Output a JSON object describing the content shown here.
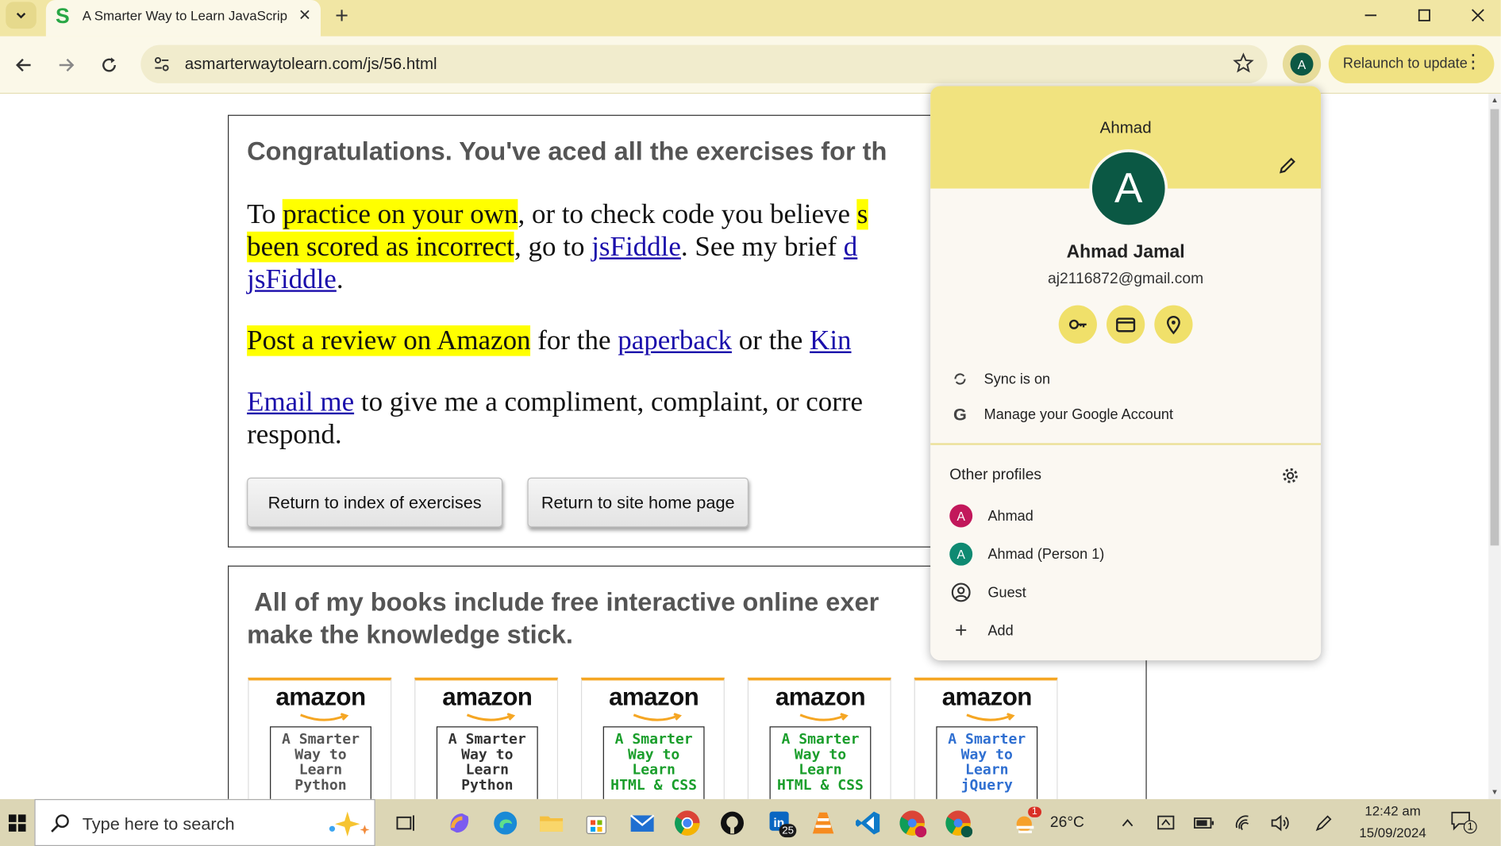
{
  "browser": {
    "tab_title": "A Smarter Way to Learn JavaScript",
    "tab_favicon": "S",
    "new_tab_symbol": "+",
    "url": "asmarterwaytolearn.com/js/56.html",
    "relaunch_label": "Relaunch to update",
    "profile_initial": "A",
    "accent_color": "#f1e6a4"
  },
  "page": {
    "heading": "Congratulations. You've aced all the exercises for th",
    "p1": {
      "t1": "To ",
      "hl1": "practice on your own",
      "t2": ", or to check code you believe ",
      "hl2": "s",
      "hl3": "been scored as incorrect",
      "t3": ", go to ",
      "link1": "jsFiddle",
      "t4": ". See my brief ",
      "link2": "d",
      "link3": "jsFiddle",
      "t5": "."
    },
    "p2": {
      "hl": "Post a review on Amazon",
      "t1": " for the ",
      "link1": "paperback",
      "t2": " or the ",
      "link2": "Kin"
    },
    "p3": {
      "link": "Email me",
      "t1": " to give me a compliment, complaint, or corre",
      "t2": "respond."
    },
    "buttons": {
      "index": "Return to index of exercises",
      "home": "Return to site home page"
    },
    "books_heading_line1": "All of my books include free interactive online exer",
    "books_heading_line2": "make the knowledge stick.",
    "books": [
      {
        "brand": "amazon",
        "l1": "A Smarter",
        "l2": "Way to",
        "l3": "Learn",
        "l4": "Python",
        "color": "#555555"
      },
      {
        "brand": "amazon",
        "l1": "A Smarter",
        "l2": "Way to",
        "l3": "Learn",
        "l4": "Python",
        "color": "#333333"
      },
      {
        "brand": "amazon",
        "l1": "A Smarter",
        "l2": "Way to",
        "l3": "Learn",
        "l4": "HTML & CSS",
        "color": "#1a9e2b"
      },
      {
        "brand": "amazon",
        "l1": "A Smarter",
        "l2": "Way to",
        "l3": "Learn",
        "l4": "HTML & CSS",
        "color": "#1a9e2b"
      },
      {
        "brand": "amazon",
        "l1": "A Smarter",
        "l2": "Way to",
        "l3": "Learn",
        "l4": "jQuery",
        "color": "#2f6fd1"
      }
    ]
  },
  "profile_menu": {
    "header_name": "Ahmad",
    "avatar_initial": "A",
    "full_name": "Ahmad Jamal",
    "email": "aj2116872@gmail.com",
    "sync_label": "Sync is on",
    "manage_label": "Manage your Google Account",
    "other_profiles_title": "Other profiles",
    "profiles": [
      {
        "initial": "A",
        "name": "Ahmad",
        "color": "#c2185b"
      },
      {
        "initial": "A",
        "name": "Ahmad (Person 1)",
        "color": "#0f8a72"
      }
    ],
    "guest_label": "Guest",
    "add_label": "Add"
  },
  "taskbar": {
    "search_placeholder": "Type here to search",
    "linkedin_badge": "25",
    "weather_badge": "1",
    "temperature": "26°C",
    "time": "12:42 am",
    "date": "15/09/2024",
    "notification_count": "1"
  }
}
